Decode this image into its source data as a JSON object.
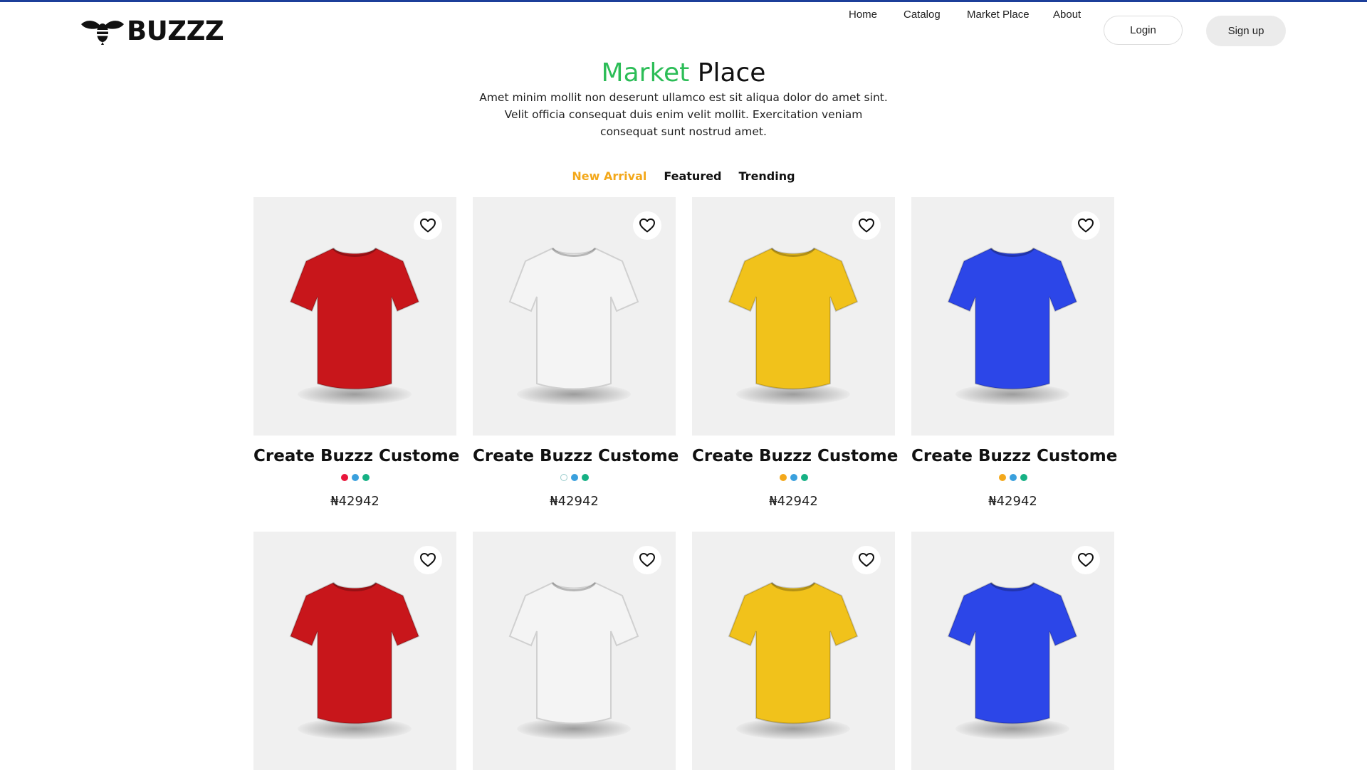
{
  "header": {
    "brand": "BUZZZ",
    "nav": [
      {
        "label": "Home"
      },
      {
        "label": "Catalog"
      },
      {
        "label": "Market Place"
      },
      {
        "label": "About"
      }
    ],
    "login_label": "Login",
    "signup_label": "Sign up"
  },
  "hero": {
    "title_accent": "Market",
    "title_rest": "Place",
    "subtitle": "Amet minim mollit non deserunt ullamco est sit aliqua dolor do amet sint. Velit officia consequat duis enim velit mollit. Exercitation veniam consequat sunt nostrud amet."
  },
  "tabs": [
    {
      "label": "New Arrival",
      "active": true
    },
    {
      "label": "Featured",
      "active": false
    },
    {
      "label": "Trending",
      "active": false
    }
  ],
  "colors": {
    "accent_green": "#2cbd57",
    "active_tab": "#f3a81b",
    "top_border": "#1c3f9a"
  },
  "products": [
    {
      "name": "Create Buzzz Custome",
      "price": "₦42942",
      "shirt_color": "#c8161b",
      "swatches": [
        "#e8163b",
        "#3aa0dd",
        "#16b184"
      ],
      "icon": "heart-icon"
    },
    {
      "name": "Create Buzzz Custome",
      "price": "₦42942",
      "shirt_color": "#f4f4f4",
      "swatches": [
        "#ffffff",
        "#3aa0dd",
        "#16b184"
      ],
      "icon": "heart-icon"
    },
    {
      "name": "Create Buzzz Custome",
      "price": "₦42942",
      "shirt_color": "#f1c21b",
      "swatches": [
        "#f3a81b",
        "#3aa0dd",
        "#16b184"
      ],
      "icon": "heart-icon"
    },
    {
      "name": "Create Buzzz Custome",
      "price": "₦42942",
      "shirt_color": "#2c46e8",
      "swatches": [
        "#f3a81b",
        "#3aa0dd",
        "#16b184"
      ],
      "icon": "heart-icon"
    },
    {
      "name": "",
      "price": "",
      "shirt_color": "#c8161b",
      "swatches": [],
      "icon": "heart-icon"
    },
    {
      "name": "",
      "price": "",
      "shirt_color": "#f4f4f4",
      "swatches": [],
      "icon": "heart-icon"
    },
    {
      "name": "",
      "price": "",
      "shirt_color": "#f1c21b",
      "swatches": [],
      "icon": "heart-icon"
    },
    {
      "name": "",
      "price": "",
      "shirt_color": "#2c46e8",
      "swatches": [],
      "icon": "heart-icon"
    }
  ]
}
